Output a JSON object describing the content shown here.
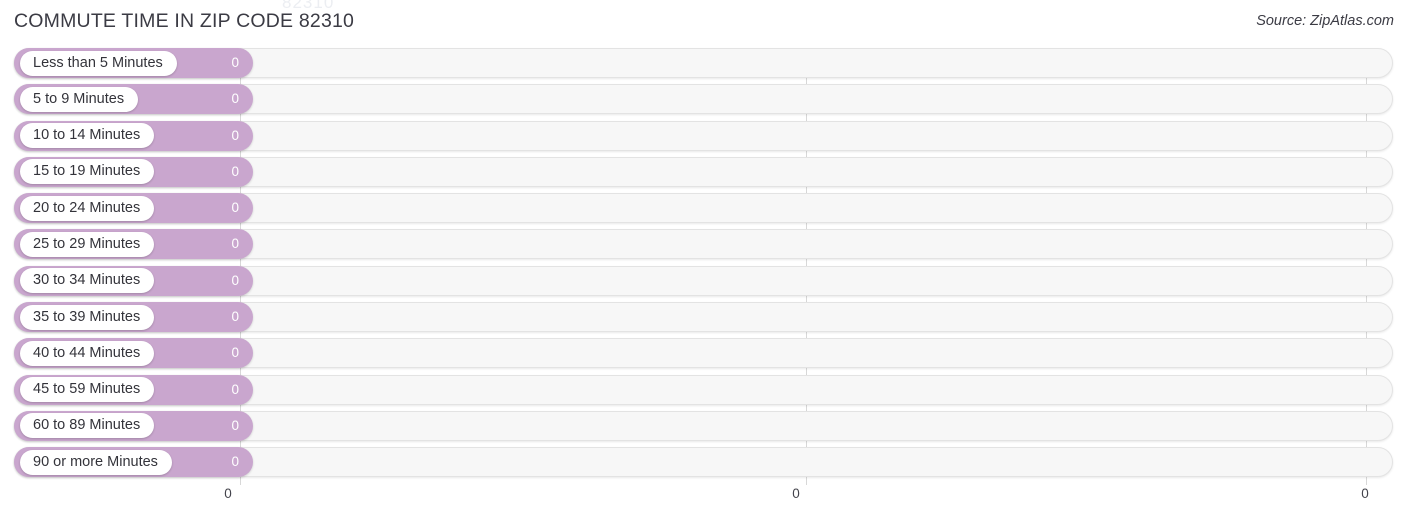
{
  "header": {
    "title": "COMMUTE TIME IN ZIP CODE 82310",
    "source": "Source: ZipAtlas.com",
    "watermark": "82310"
  },
  "chart_data": {
    "type": "bar",
    "orientation": "horizontal",
    "title": "COMMUTE TIME IN ZIP CODE 82310",
    "xlabel": "",
    "ylabel": "",
    "grid": true,
    "legend": "none",
    "bar_color": "#c9a6ce",
    "track_color": "#f7f7f7",
    "categories": [
      "Less than 5 Minutes",
      "5 to 9 Minutes",
      "10 to 14 Minutes",
      "15 to 19 Minutes",
      "20 to 24 Minutes",
      "25 to 29 Minutes",
      "30 to 34 Minutes",
      "35 to 39 Minutes",
      "40 to 44 Minutes",
      "45 to 59 Minutes",
      "60 to 89 Minutes",
      "90 or more Minutes"
    ],
    "values": [
      0,
      0,
      0,
      0,
      0,
      0,
      0,
      0,
      0,
      0,
      0,
      0
    ],
    "value_labels": [
      "0",
      "0",
      "0",
      "0",
      "0",
      "0",
      "0",
      "0",
      "0",
      "0",
      "0",
      "0"
    ],
    "xticks": [
      "0",
      "0",
      "0"
    ],
    "xlim": [
      0,
      0
    ]
  }
}
